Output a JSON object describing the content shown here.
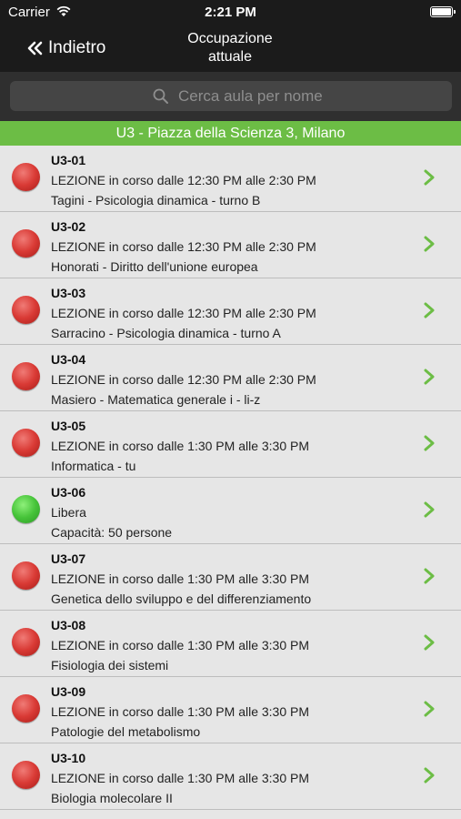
{
  "status_bar": {
    "carrier": "Carrier",
    "time": "2:21 PM"
  },
  "nav": {
    "back_label": "Indietro",
    "title_line1": "Occupazione",
    "title_line2": "attuale"
  },
  "search": {
    "placeholder": "Cerca aula per nome"
  },
  "section": {
    "title": "U3 - Piazza della Scienza 3, Milano"
  },
  "colors": {
    "busy": "#d93a35",
    "free": "#47c43a",
    "accent": "#6cbd45",
    "nav_bg": "#1b1b1b"
  },
  "rooms": [
    {
      "name": "U3-01",
      "status": "LEZIONE in corso dalle 12:30 PM alle 2:30 PM",
      "detail": "Tagini - Psicologia dinamica - turno B",
      "state": "busy"
    },
    {
      "name": "U3-02",
      "status": "LEZIONE in corso dalle 12:30 PM alle 2:30 PM",
      "detail": "Honorati - Diritto dell'unione europea",
      "state": "busy"
    },
    {
      "name": "U3-03",
      "status": "LEZIONE in corso dalle 12:30 PM alle 2:30 PM",
      "detail": "Sarracino - Psicologia dinamica - turno A",
      "state": "busy"
    },
    {
      "name": "U3-04",
      "status": "LEZIONE in corso dalle 12:30 PM alle 2:30 PM",
      "detail": "Masiero - Matematica generale i - li-z",
      "state": "busy"
    },
    {
      "name": "U3-05",
      "status": "LEZIONE in corso dalle 1:30 PM alle 3:30 PM",
      "detail": "Informatica - tu",
      "state": "busy"
    },
    {
      "name": "U3-06",
      "status": "Libera",
      "detail": "Capacità: 50 persone",
      "state": "free"
    },
    {
      "name": "U3-07",
      "status": "LEZIONE in corso dalle 1:30 PM alle 3:30 PM",
      "detail": "Genetica dello sviluppo e del differenziamento",
      "state": "busy"
    },
    {
      "name": "U3-08",
      "status": "LEZIONE in corso dalle 1:30 PM alle 3:30 PM",
      "detail": "Fisiologia dei sistemi",
      "state": "busy"
    },
    {
      "name": "U3-09",
      "status": "LEZIONE in corso dalle 1:30 PM alle 3:30 PM",
      "detail": "Patologie del metabolismo",
      "state": "busy"
    },
    {
      "name": "U3-10",
      "status": "LEZIONE in corso dalle 1:30 PM alle 3:30 PM",
      "detail": "Biologia molecolare II",
      "state": "busy"
    }
  ]
}
